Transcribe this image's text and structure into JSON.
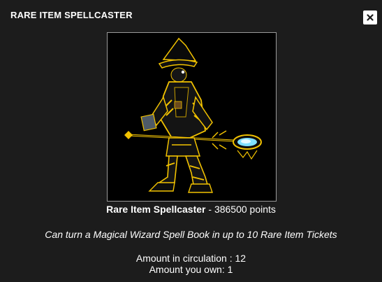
{
  "modal": {
    "title": "RARE ITEM SPELLCASTER",
    "close_icon": "close-icon"
  },
  "item": {
    "image_icon": "spellcaster-character-image",
    "name": "Rare Item Spellcaster",
    "separator": " - ",
    "points": "386500 points",
    "description": "Can turn a Magical Wizard Spell Book in up to 10 Rare Item Tickets",
    "circulation_text": "Amount in circulation : 12",
    "owned_text": "Amount you own: 1"
  },
  "colors": {
    "background": "#1c1c1c",
    "text": "#ffffff",
    "frame_border": "#9a9a9a",
    "accent_gold": "#f2c200",
    "accent_cyan": "#7fe0ff"
  }
}
